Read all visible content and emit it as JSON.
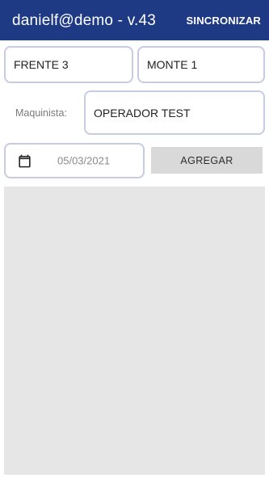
{
  "appbar": {
    "title": "danielf@demo - v.43",
    "action_label": "SINCRONIZAR"
  },
  "form": {
    "frente_value": "FRENTE 3",
    "monte_value": "MONTE 1",
    "maquinista_label": "Maquinista:",
    "maquinista_value": "OPERADOR TEST",
    "date_value": "05/03/2021",
    "add_button_label": "AGREGAR"
  },
  "icons": {
    "date": "calendar-icon"
  },
  "colors": {
    "appbar_bg": "#1e3a85",
    "field_border": "#c6cbe6",
    "button_bg": "#d9d9d9",
    "list_bg": "#e6e6e6"
  }
}
